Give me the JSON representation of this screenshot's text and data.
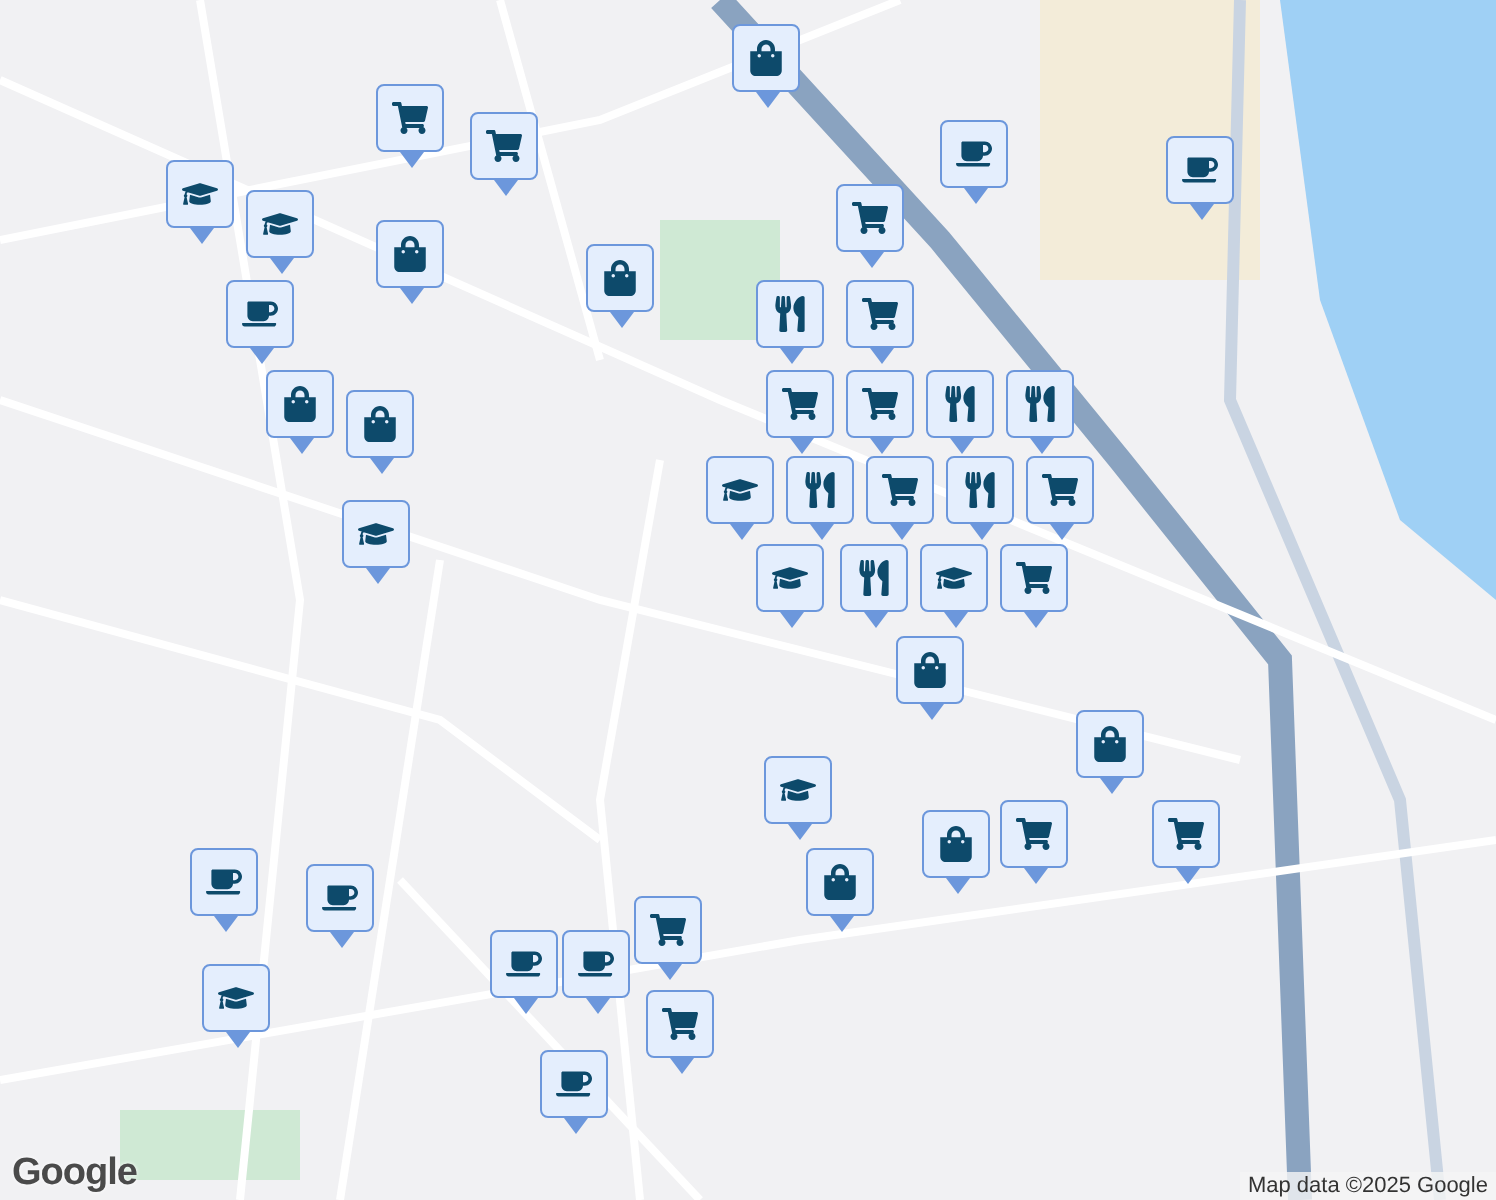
{
  "map": {
    "pins": [
      {
        "kind": "bag"
      },
      {
        "kind": "cart"
      },
      {
        "kind": "cart"
      },
      {
        "kind": "school"
      },
      {
        "kind": "school"
      },
      {
        "kind": "cup"
      },
      {
        "kind": "cup"
      },
      {
        "kind": "bag"
      },
      {
        "kind": "bag"
      },
      {
        "kind": "cup"
      },
      {
        "kind": "cart"
      },
      {
        "kind": "fork"
      },
      {
        "kind": "cart"
      },
      {
        "kind": "bag"
      },
      {
        "kind": "bag"
      },
      {
        "kind": "cart"
      },
      {
        "kind": "cart"
      },
      {
        "kind": "fork"
      },
      {
        "kind": "fork"
      },
      {
        "kind": "cart"
      },
      {
        "kind": "fork"
      },
      {
        "kind": "fork"
      },
      {
        "kind": "cart"
      },
      {
        "kind": "cart"
      },
      {
        "kind": "school"
      },
      {
        "kind": "fork"
      },
      {
        "kind": "school"
      },
      {
        "kind": "school"
      },
      {
        "kind": "school"
      },
      {
        "kind": "bag"
      },
      {
        "kind": "bag"
      },
      {
        "kind": "school"
      },
      {
        "kind": "cart"
      },
      {
        "kind": "cart"
      },
      {
        "kind": "bag"
      },
      {
        "kind": "bag"
      },
      {
        "kind": "cart"
      },
      {
        "kind": "cup"
      },
      {
        "kind": "cup"
      },
      {
        "kind": "cart"
      },
      {
        "kind": "cup"
      },
      {
        "kind": "cup"
      },
      {
        "kind": "school"
      },
      {
        "kind": "cup"
      }
    ]
  },
  "logo": "Google",
  "attribution": "Map data ©2025 Google"
}
